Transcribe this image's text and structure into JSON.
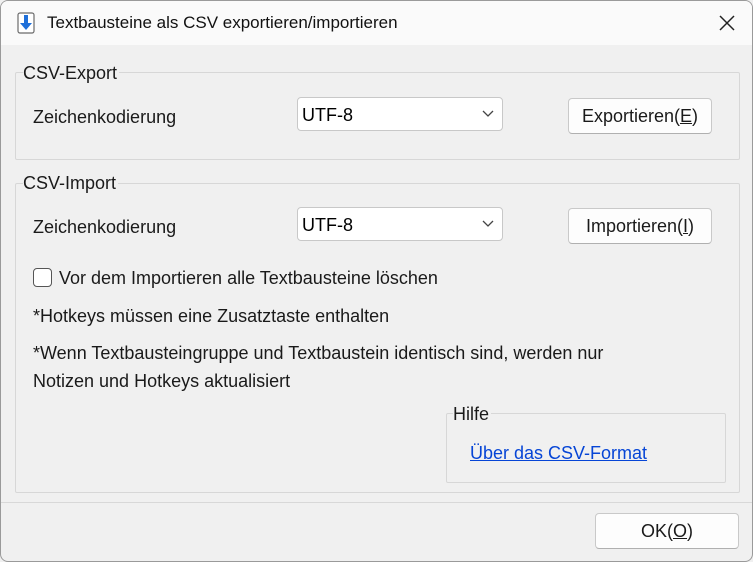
{
  "window": {
    "title": "Textbausteine als CSV exportieren/importieren",
    "app_icon": "download-arrow-icon",
    "close_icon": "close-icon"
  },
  "export": {
    "legend": "CSV-Export",
    "encoding_label": "Zeichenkodierung",
    "encoding_value": "UTF-8",
    "button_pre": "Exportieren(",
    "button_key": "E",
    "button_post": ")"
  },
  "import": {
    "legend": "CSV-Import",
    "encoding_label": "Zeichenkodierung",
    "encoding_value": "UTF-8",
    "button_pre": "Importieren(",
    "button_key": "I",
    "button_post": ")",
    "delete_checkbox_label": "Vor dem Importieren alle Textbausteine löschen",
    "delete_checkbox_checked": false,
    "note1": "*Hotkeys müssen eine Zusatztaste enthalten",
    "note2_line1": "*Wenn Textbausteingruppe und Textbaustein identisch sind, werden nur",
    "note2_line2": "Notizen und Hotkeys aktualisiert"
  },
  "help": {
    "legend": "Hilfe",
    "link": "Über das CSV-Format"
  },
  "footer": {
    "ok_pre": "OK(",
    "ok_key": "O",
    "ok_post": ")"
  },
  "colors": {
    "accent": "#0645d6",
    "icon_blue": "#1e6fd9"
  }
}
